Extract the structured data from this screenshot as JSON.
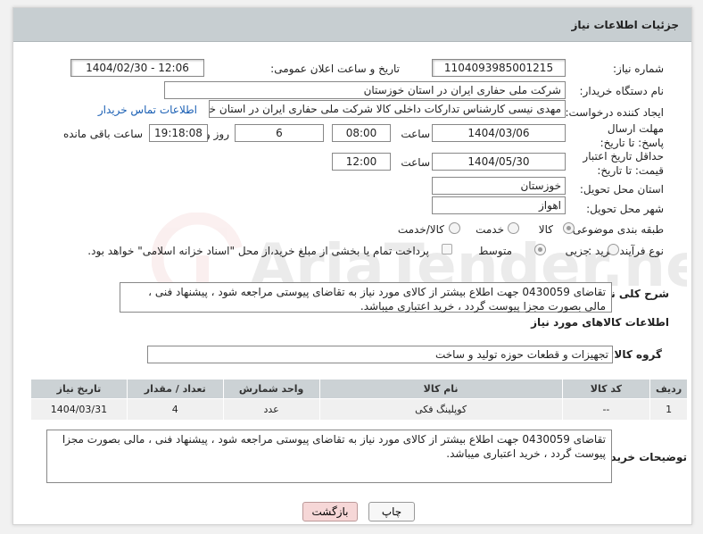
{
  "header": {
    "title": "جزئیات اطلاعات نیاز"
  },
  "fields": {
    "need_number_label": "شماره نیاز:",
    "need_number": "1104093985001215",
    "announce_label": "تاریخ و ساعت اعلان عمومی:",
    "announce_value": "1404/02/30 - 12:06",
    "buyer_org_label": "نام دستگاه خریدار:",
    "buyer_org": "شرکت ملی حفاری ایران در استان خوزستان",
    "requester_label": "ایجاد کننده درخواست:",
    "requester": "مهدی نیسی کارشناس تدارکات داخلی کالا شرکت ملی حفاری ایران در استان خوزستان",
    "contact_link": "اطلاعات تماس خریدار",
    "deadline_label": "مهلت ارسال پاسخ: تا تاریخ:",
    "deadline_date": "1404/03/06",
    "time_label": "ساعت",
    "deadline_time": "08:00",
    "days_value": "6",
    "days_label": "روز و",
    "remaining_time": "19:18:08",
    "remaining_label": "ساعت باقی مانده",
    "validity_label": "حداقل تاریخ اعتبار قیمت: تا تاریخ:",
    "validity_date": "1404/05/30",
    "validity_time": "12:00",
    "province_label": "استان محل تحویل:",
    "province": "خوزستان",
    "city_label": "شهر محل تحویل:",
    "city": "اهواز",
    "category_label": "طبقه بندی موضوعی:",
    "category_options": [
      "کالا",
      "خدمت",
      "کالا/خدمت"
    ],
    "process_label": "نوع فرآیند خرید :",
    "process_options": [
      "جزیی",
      "متوسط"
    ],
    "payment_note": "پرداخت تمام یا بخشی از مبلغ خرید،از محل \"اسناد خزانه اسلامی\" خواهد بود."
  },
  "description": {
    "label": "شرح کلی نیاز:",
    "text": "تقاضای 0430059 جهت اطلاع بیشتر از کالای مورد نیاز به تقاضای پیوستی مراجعه شود ، پیشنهاد فنی ، مالی بصورت مجزا پیوست گردد ، خرید اعتباری میباشد."
  },
  "goods": {
    "section_title": "اطلاعات کالاهای مورد نیاز",
    "group_label": "گروه کالا:",
    "group_value": "تجهیزات و قطعات حوزه تولید و ساخت",
    "columns": [
      "ردیف",
      "کد کالا",
      "نام کالا",
      "واحد شمارش",
      "تعداد / مقدار",
      "تاریخ نیاز"
    ],
    "rows": [
      [
        "1",
        "--",
        "کوپلینگ فکی",
        "عدد",
        "4",
        "1404/03/31"
      ]
    ]
  },
  "buyer_notes": {
    "label": "توضیحات خریدار:",
    "text": "تقاضای 0430059 جهت اطلاع بیشتر از کالای مورد نیاز به تقاضای پیوستی مراجعه شود ، پیشنهاد فنی ، مالی بصورت مجزا پیوست گردد ، خرید اعتباری میباشد."
  },
  "buttons": {
    "print": "چاپ",
    "back": "بازگشت"
  },
  "watermark": {
    "text": "AriaTender.neT"
  }
}
